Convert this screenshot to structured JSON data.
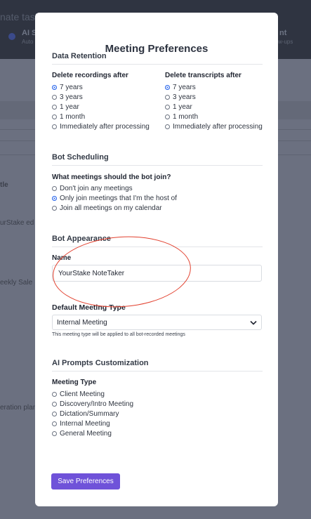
{
  "background": {
    "header_title": "nate tasks",
    "ai_label": "AI S",
    "ai_sub": "Auto",
    "right_label": "nt",
    "right_sub": "w-ups",
    "row_texts": [
      "tle",
      "urStake ed",
      "eekly Sale",
      "eration plan"
    ]
  },
  "modal": {
    "title": "Meeting Preferences",
    "data_retention": {
      "title": "Data Retention",
      "recordings": {
        "label": "Delete recordings after",
        "options": [
          "7 years",
          "3 years",
          "1 year",
          "1 month",
          "Immediately after processing"
        ],
        "selected": "7 years"
      },
      "transcripts": {
        "label": "Delete transcripts after",
        "options": [
          "7 years",
          "3 years",
          "1 year",
          "1 month",
          "Immediately after processing"
        ],
        "selected": "7 years"
      }
    },
    "bot_scheduling": {
      "title": "Bot Scheduling",
      "question": "What meetings should the bot join?",
      "options": [
        "Don't join any meetings",
        "Only join meetings that I'm the host of",
        "Join all meetings on my calendar"
      ],
      "selected": "Only join meetings that I'm the host of"
    },
    "bot_appearance": {
      "title": "Bot Appearance",
      "name_label": "Name",
      "name_value": "YourStake NoteTaker"
    },
    "default_meeting_type": {
      "label": "Default Meeting Type",
      "selected": "Internal Meeting",
      "hint": "This meeting type will be applied to all bot-recorded meetings"
    },
    "ai_prompts": {
      "title": "AI Prompts Customization",
      "label": "Meeting Type",
      "options": [
        "Client Meeting",
        "Discovery/Intro Meeting",
        "Dictation/Summary",
        "Internal Meeting",
        "General Meeting"
      ]
    },
    "save_label": "Save Preferences"
  },
  "colors": {
    "accent": "#6f52d9",
    "radio_selected": "#2563eb",
    "annotation": "#e2412f"
  }
}
